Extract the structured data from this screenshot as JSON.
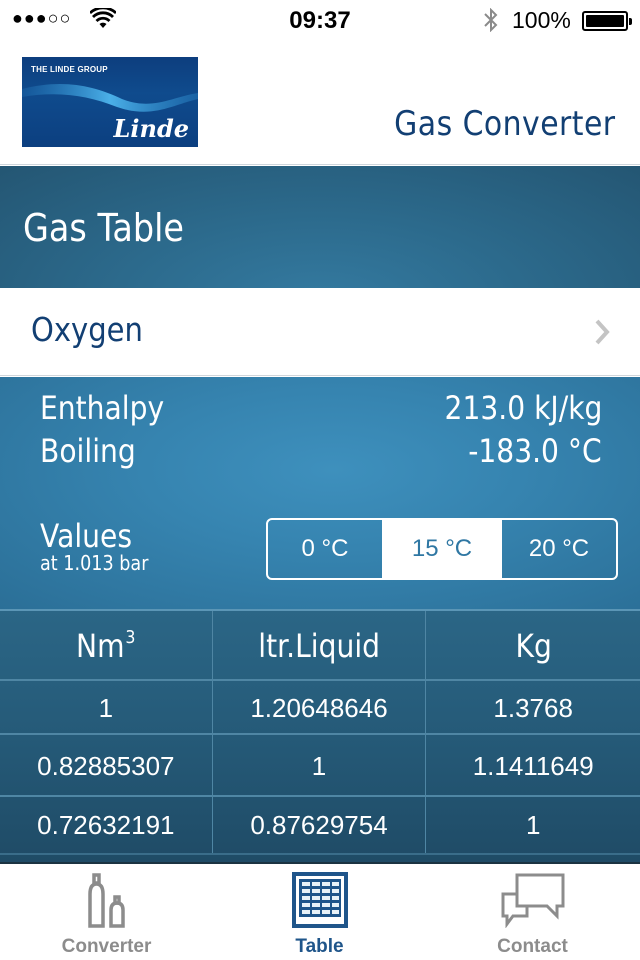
{
  "status_bar": {
    "signal": "●●●○○",
    "wifi_icon": "wifi-icon",
    "time": "09:37",
    "bluetooth_icon": "bluetooth-icon",
    "battery_percent": "100%",
    "battery_icon": "battery-icon"
  },
  "header": {
    "logo_group": "THE LINDE GROUP",
    "logo_brand": "Linde",
    "app_title": "Gas Converter"
  },
  "section": {
    "title": "Gas Table"
  },
  "gas_selector": {
    "selected_gas": "Oxygen",
    "chevron_icon": "chevron-right-icon"
  },
  "properties": [
    {
      "label": "Enthalpy",
      "value": "213.0 kJ/kg"
    },
    {
      "label": "Boiling",
      "value": "-183.0 °C"
    }
  ],
  "values_label": {
    "title": "Values",
    "subtitle": "at 1.013 bar"
  },
  "temperature_segments": {
    "options": [
      "0 °C",
      "15 °C",
      "20 °C"
    ],
    "selected": "15 °C"
  },
  "conversion_table": {
    "columns": [
      {
        "label": "Nm",
        "superscript": "3"
      },
      {
        "label": "ltr.Liquid",
        "superscript": ""
      },
      {
        "label": "Kg",
        "superscript": ""
      }
    ],
    "rows": [
      [
        "1",
        "1.20648646",
        "1.3768"
      ],
      [
        "0.82885307",
        "1",
        "1.1411649"
      ],
      [
        "0.72632191",
        "0.87629754",
        "1"
      ]
    ]
  },
  "tab_bar": {
    "tabs": [
      {
        "label": "Converter",
        "icon": "gas-cylinders-icon",
        "active": false
      },
      {
        "label": "Table",
        "icon": "table-icon",
        "active": true
      },
      {
        "label": "Contact",
        "icon": "chat-bubbles-icon",
        "active": false
      }
    ]
  },
  "colors": {
    "brand_navy": "#123f73",
    "active_tab": "#1f558a",
    "inactive_tab": "#8c8c8c",
    "panel_blue": "#3684b0",
    "table_blue": "#255a78"
  }
}
